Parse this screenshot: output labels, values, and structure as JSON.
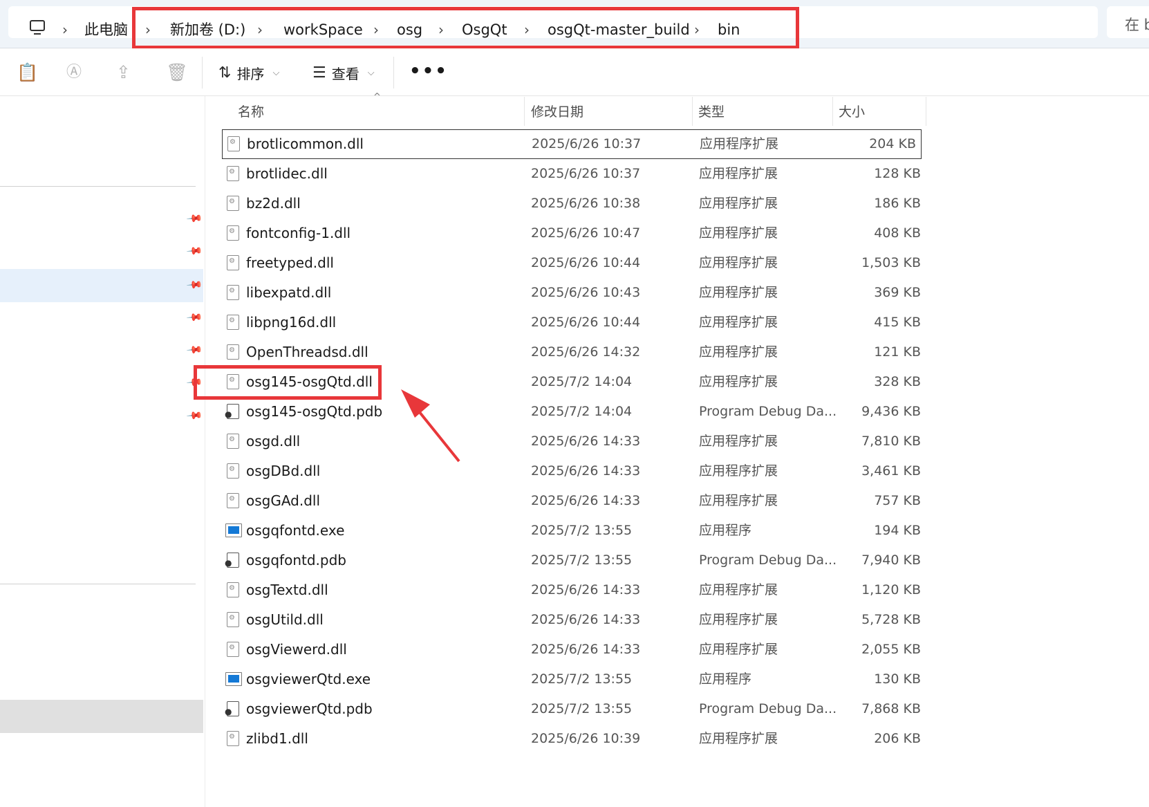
{
  "address_bar": {
    "crumbs": [
      "此电脑",
      "新加卷 (D:)",
      "workSpace",
      "osg",
      "OsgQt",
      "osgQt-master_build",
      "bin"
    ],
    "search_placeholder": "在 b"
  },
  "toolbar": {
    "sort_label": "排序",
    "view_label": "查看",
    "more_label": "•••"
  },
  "columns": {
    "name": "名称",
    "modified": "修改日期",
    "type": "类型",
    "size": "大小"
  },
  "files": [
    {
      "icon": "dll",
      "name": "brotlicommon.dll",
      "modified": "2025/6/26 10:37",
      "type": "应用程序扩展",
      "size": "204 KB"
    },
    {
      "icon": "dll",
      "name": "brotlidec.dll",
      "modified": "2025/6/26 10:37",
      "type": "应用程序扩展",
      "size": "128 KB"
    },
    {
      "icon": "dll",
      "name": "bz2d.dll",
      "modified": "2025/6/26 10:38",
      "type": "应用程序扩展",
      "size": "186 KB"
    },
    {
      "icon": "dll",
      "name": "fontconfig-1.dll",
      "modified": "2025/6/26 10:47",
      "type": "应用程序扩展",
      "size": "408 KB"
    },
    {
      "icon": "dll",
      "name": "freetyped.dll",
      "modified": "2025/6/26 10:44",
      "type": "应用程序扩展",
      "size": "1,503 KB"
    },
    {
      "icon": "dll",
      "name": "libexpatd.dll",
      "modified": "2025/6/26 10:43",
      "type": "应用程序扩展",
      "size": "369 KB"
    },
    {
      "icon": "dll",
      "name": "libpng16d.dll",
      "modified": "2025/6/26 10:44",
      "type": "应用程序扩展",
      "size": "415 KB"
    },
    {
      "icon": "dll",
      "name": "OpenThreadsd.dll",
      "modified": "2025/6/26 14:32",
      "type": "应用程序扩展",
      "size": "121 KB"
    },
    {
      "icon": "dll",
      "name": "osg145-osgQtd.dll",
      "modified": "2025/7/2 14:04",
      "type": "应用程序扩展",
      "size": "328 KB"
    },
    {
      "icon": "pdb",
      "name": "osg145-osgQtd.pdb",
      "modified": "2025/7/2 14:04",
      "type": "Program Debug Da...",
      "size": "9,436 KB"
    },
    {
      "icon": "dll",
      "name": "osgd.dll",
      "modified": "2025/6/26 14:33",
      "type": "应用程序扩展",
      "size": "7,810 KB"
    },
    {
      "icon": "dll",
      "name": "osgDBd.dll",
      "modified": "2025/6/26 14:33",
      "type": "应用程序扩展",
      "size": "3,461 KB"
    },
    {
      "icon": "dll",
      "name": "osgGAd.dll",
      "modified": "2025/6/26 14:33",
      "type": "应用程序扩展",
      "size": "757 KB"
    },
    {
      "icon": "exe",
      "name": "osgqfontd.exe",
      "modified": "2025/7/2 13:55",
      "type": "应用程序",
      "size": "194 KB"
    },
    {
      "icon": "pdb",
      "name": "osgqfontd.pdb",
      "modified": "2025/7/2 13:55",
      "type": "Program Debug Da...",
      "size": "7,940 KB"
    },
    {
      "icon": "dll",
      "name": "osgTextd.dll",
      "modified": "2025/6/26 14:33",
      "type": "应用程序扩展",
      "size": "1,120 KB"
    },
    {
      "icon": "dll",
      "name": "osgUtild.dll",
      "modified": "2025/6/26 14:33",
      "type": "应用程序扩展",
      "size": "5,728 KB"
    },
    {
      "icon": "dll",
      "name": "osgViewerd.dll",
      "modified": "2025/6/26 14:33",
      "type": "应用程序扩展",
      "size": "2,055 KB"
    },
    {
      "icon": "exe",
      "name": "osgviewerQtd.exe",
      "modified": "2025/7/2 13:55",
      "type": "应用程序",
      "size": "130 KB"
    },
    {
      "icon": "pdb",
      "name": "osgviewerQtd.pdb",
      "modified": "2025/7/2 13:55",
      "type": "Program Debug Da...",
      "size": "7,868 KB"
    },
    {
      "icon": "dll",
      "name": "zlibd1.dll",
      "modified": "2025/6/26 10:39",
      "type": "应用程序扩展",
      "size": "206 KB"
    }
  ],
  "colors": {
    "annotation_red": "#e8373a",
    "nav_selected": "#e6f0fb",
    "exe_blue": "#1479d6"
  },
  "icons": {
    "toolbar": [
      "paste-icon",
      "rename-icon",
      "share-icon",
      "delete-icon",
      "sort-icon",
      "view-icon"
    ],
    "nav_pin": "pin-icon",
    "address": "computer-icon"
  }
}
